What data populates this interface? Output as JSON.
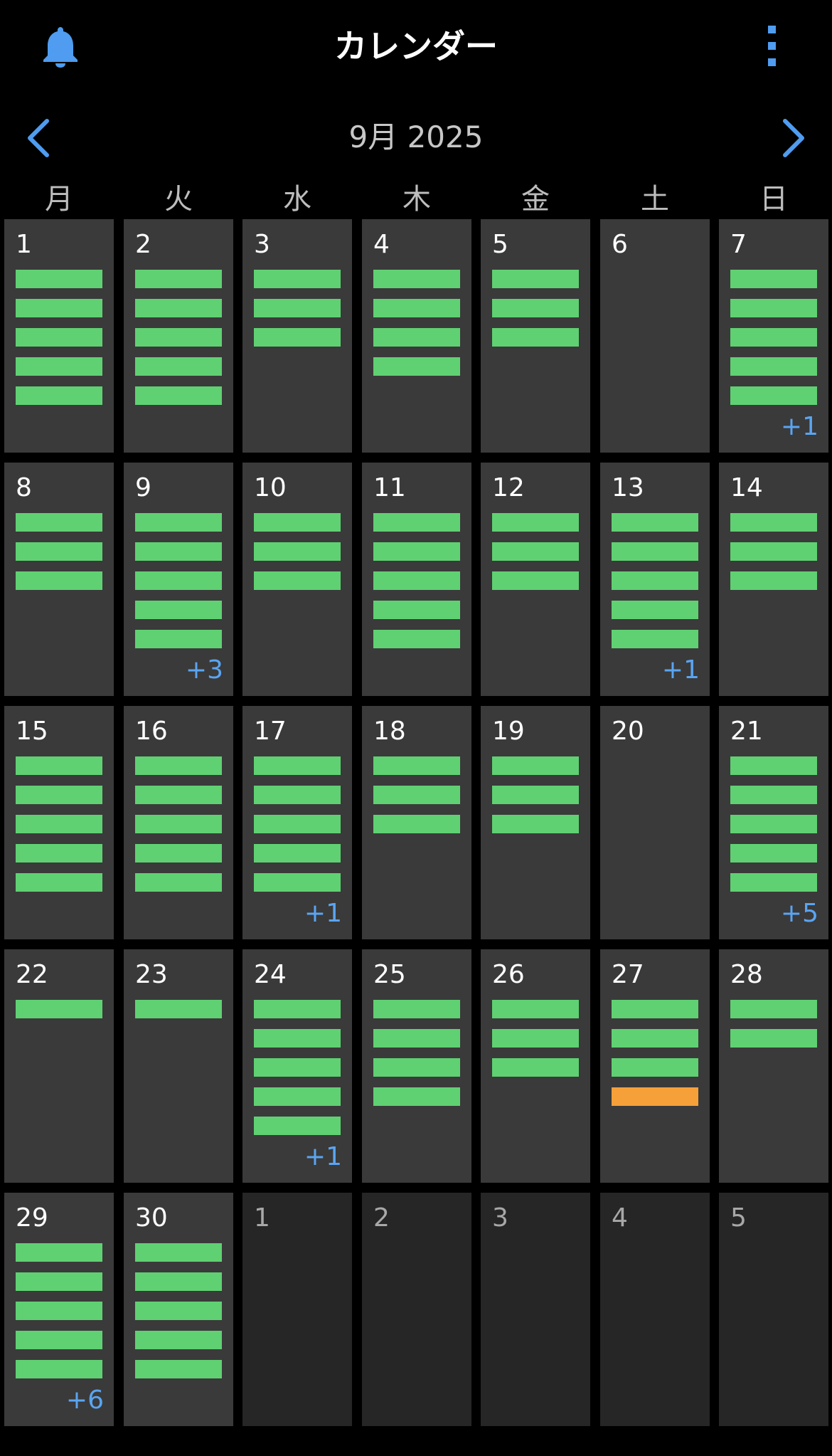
{
  "header": {
    "title": "カレンダー",
    "bell_icon": "bell-icon",
    "menu_icon": "more-vertical-icon"
  },
  "nav": {
    "month_label": "9月 2025",
    "prev_icon": "chevron-left-icon",
    "next_icon": "chevron-right-icon"
  },
  "colors": {
    "accent": "#5aa5f2",
    "event_green": "#5fd172",
    "event_orange": "#f6a03a",
    "cell_bg": "#3a3a3a",
    "cell_other_bg": "#262626"
  },
  "weekdays": [
    "月",
    "火",
    "水",
    "木",
    "金",
    "土",
    "日"
  ],
  "weeks": [
    [
      {
        "day": "1",
        "events": [
          "g",
          "g",
          "g",
          "g",
          "g"
        ],
        "more": ""
      },
      {
        "day": "2",
        "events": [
          "g",
          "g",
          "g",
          "g",
          "g"
        ],
        "more": ""
      },
      {
        "day": "3",
        "events": [
          "g",
          "g",
          "g"
        ],
        "more": ""
      },
      {
        "day": "4",
        "events": [
          "g",
          "g",
          "g",
          "g"
        ],
        "more": ""
      },
      {
        "day": "5",
        "events": [
          "g",
          "g",
          "g"
        ],
        "more": ""
      },
      {
        "day": "6",
        "events": [],
        "more": ""
      },
      {
        "day": "7",
        "events": [
          "g",
          "g",
          "g",
          "g",
          "g"
        ],
        "more": "+1"
      }
    ],
    [
      {
        "day": "8",
        "events": [
          "g",
          "g",
          "g"
        ],
        "more": ""
      },
      {
        "day": "9",
        "events": [
          "g",
          "g",
          "g",
          "g",
          "g"
        ],
        "more": "+3"
      },
      {
        "day": "10",
        "events": [
          "g",
          "g",
          "g"
        ],
        "more": ""
      },
      {
        "day": "11",
        "events": [
          "g",
          "g",
          "g",
          "g",
          "g"
        ],
        "more": ""
      },
      {
        "day": "12",
        "events": [
          "g",
          "g",
          "g"
        ],
        "more": ""
      },
      {
        "day": "13",
        "events": [
          "g",
          "g",
          "g",
          "g",
          "g"
        ],
        "more": "+1"
      },
      {
        "day": "14",
        "events": [
          "g",
          "g",
          "g"
        ],
        "more": ""
      }
    ],
    [
      {
        "day": "15",
        "events": [
          "g",
          "g",
          "g",
          "g",
          "g"
        ],
        "more": ""
      },
      {
        "day": "16",
        "events": [
          "g",
          "g",
          "g",
          "g",
          "g"
        ],
        "more": ""
      },
      {
        "day": "17",
        "events": [
          "g",
          "g",
          "g",
          "g",
          "g"
        ],
        "more": "+1"
      },
      {
        "day": "18",
        "events": [
          "g",
          "g",
          "g"
        ],
        "more": ""
      },
      {
        "day": "19",
        "events": [
          "g",
          "g",
          "g"
        ],
        "more": ""
      },
      {
        "day": "20",
        "events": [],
        "more": ""
      },
      {
        "day": "21",
        "events": [
          "g",
          "g",
          "g",
          "g",
          "g"
        ],
        "more": "+5"
      }
    ],
    [
      {
        "day": "22",
        "events": [
          "g"
        ],
        "more": ""
      },
      {
        "day": "23",
        "events": [
          "g"
        ],
        "more": ""
      },
      {
        "day": "24",
        "events": [
          "g",
          "g",
          "g",
          "g",
          "g"
        ],
        "more": "+1"
      },
      {
        "day": "25",
        "events": [
          "g",
          "g",
          "g",
          "g"
        ],
        "more": ""
      },
      {
        "day": "26",
        "events": [
          "g",
          "g",
          "g"
        ],
        "more": ""
      },
      {
        "day": "27",
        "events": [
          "g",
          "g",
          "g",
          "o"
        ],
        "more": ""
      },
      {
        "day": "28",
        "events": [
          "g",
          "g"
        ],
        "more": ""
      }
    ],
    [
      {
        "day": "29",
        "events": [
          "g",
          "g",
          "g",
          "g",
          "g"
        ],
        "more": "+6"
      },
      {
        "day": "30",
        "events": [
          "g",
          "g",
          "g",
          "g",
          "g"
        ],
        "more": ""
      },
      {
        "day": "1",
        "events": [],
        "more": "",
        "other_month": true
      },
      {
        "day": "2",
        "events": [],
        "more": "",
        "other_month": true
      },
      {
        "day": "3",
        "events": [],
        "more": "",
        "other_month": true
      },
      {
        "day": "4",
        "events": [],
        "more": "",
        "other_month": true
      },
      {
        "day": "5",
        "events": [],
        "more": "",
        "other_month": true
      }
    ]
  ]
}
